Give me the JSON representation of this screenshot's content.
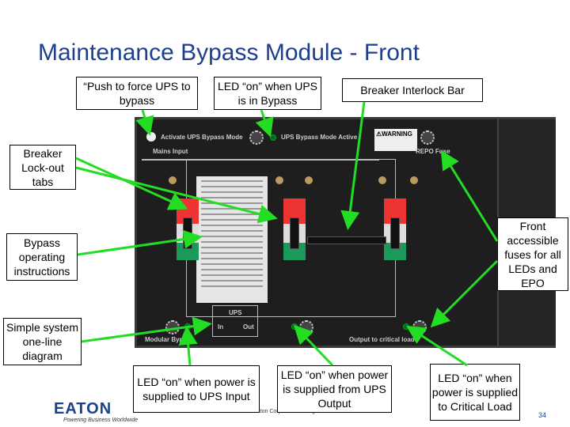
{
  "title": "Maintenance Bypass Module - Front",
  "callouts": {
    "push": "“Push to force UPS to bypass",
    "led_bypass": "LED “on” when UPS is in Bypass",
    "interlock": "Breaker Interlock Bar",
    "lockout": "Breaker Lock-out tabs",
    "instructions": "Bypass operating instructions",
    "oneline": "Simple system one-line diagram",
    "fuses": "Front accessible fuses for all LEDs and EPO",
    "led_input": "LED “on” when power is supplied to UPS Input",
    "led_output": "LED “on” when power is supplied from UPS Output",
    "led_load": "LED “on” when power is supplied to Critical Load"
  },
  "panel_labels": {
    "activate": "Activate UPS Bypass Mode",
    "active": "UPS Bypass Mode Active",
    "mains": "Mains Input",
    "warning": "⚠WARNING",
    "repo": "REPO Fuse",
    "modular": "Modular Bypass",
    "ups": "UPS",
    "in": "In",
    "out": "Out",
    "output": "Output to critical loads"
  },
  "footer": {
    "logo": "EATON",
    "tagline": "Powering Business Worldwide",
    "copyright": "© 2011 Eaton Corporation. All rights reserved.",
    "page": "34"
  },
  "colors": {
    "title": "#1d3f8f",
    "arrow": "#22dd22"
  }
}
